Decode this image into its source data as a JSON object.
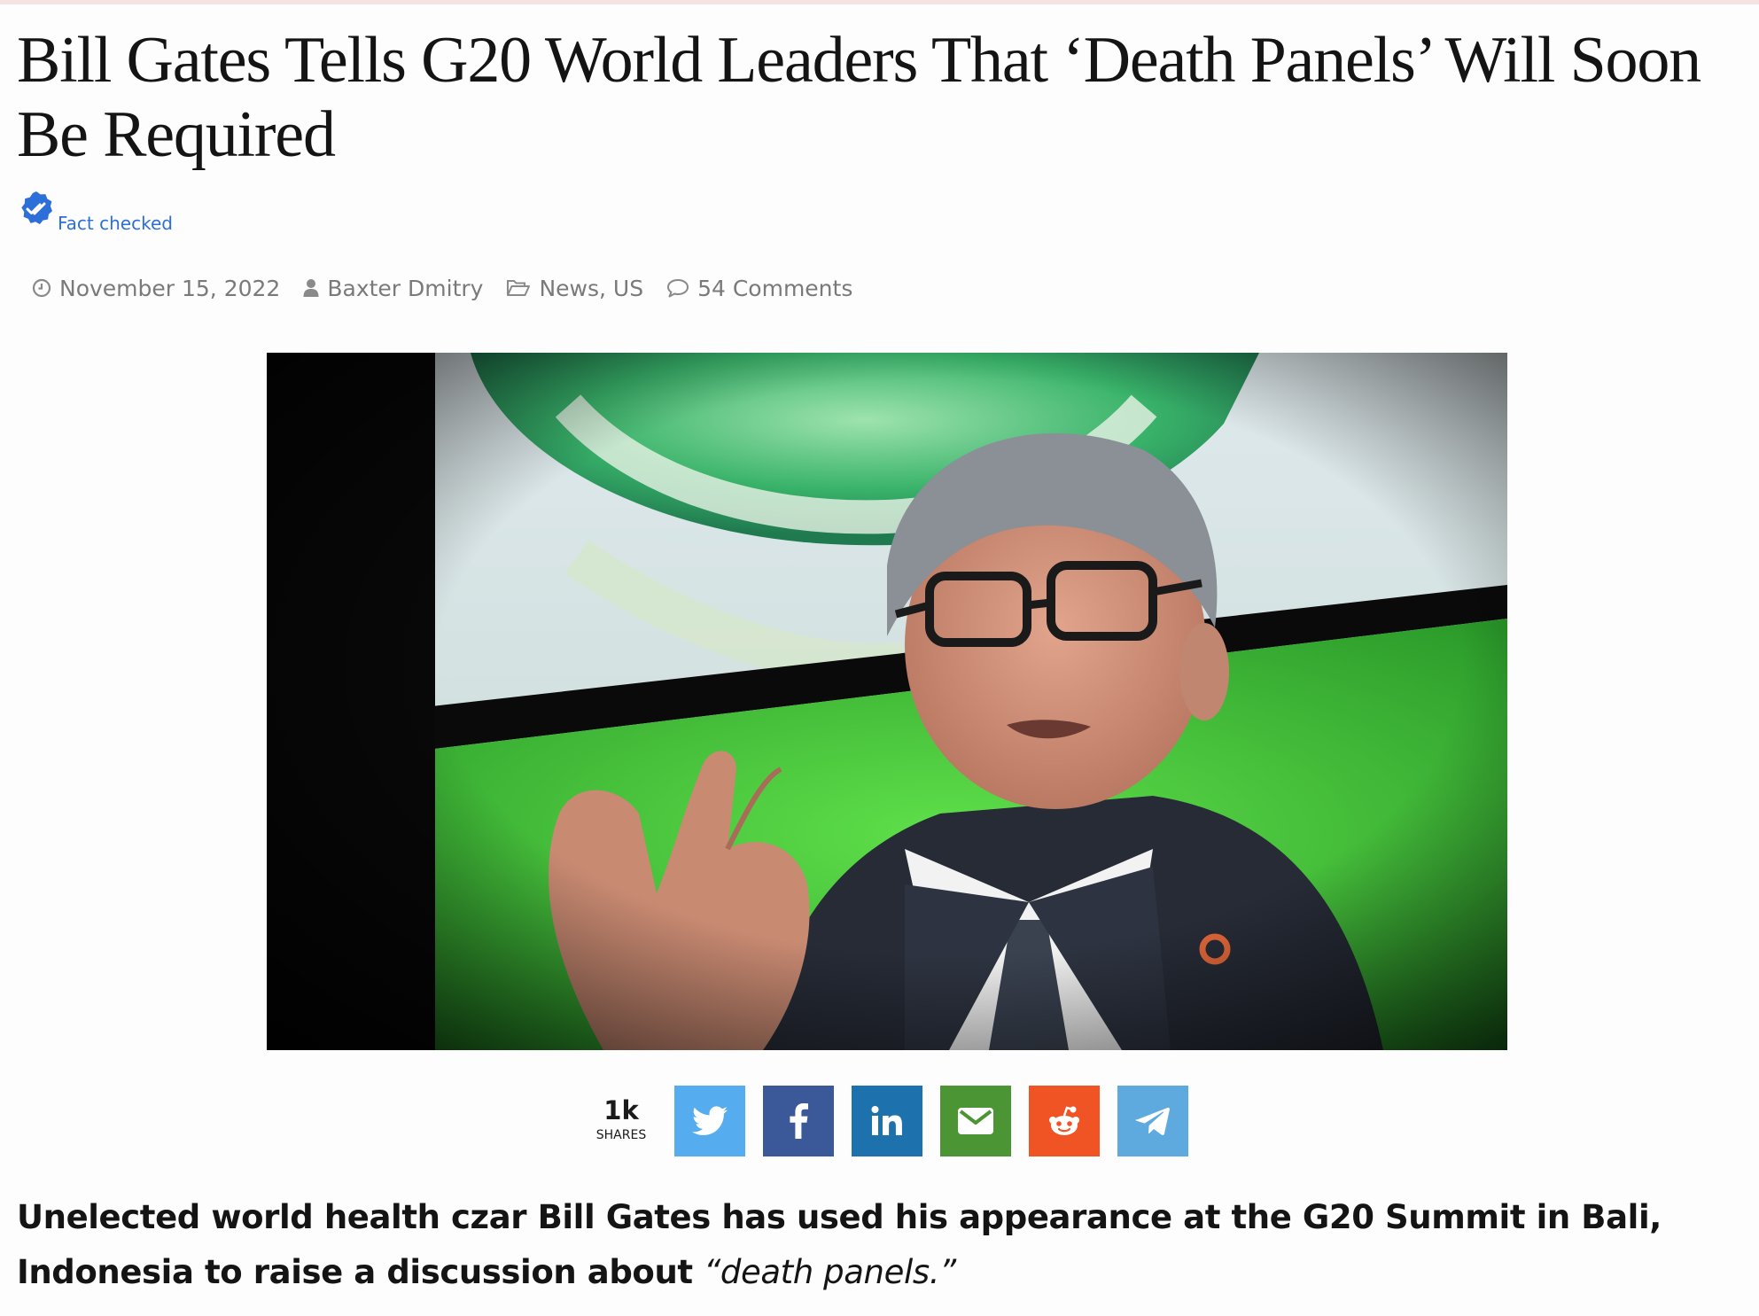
{
  "article": {
    "headline": "Bill Gates Tells G20 World Leaders That ‘Death Panels’ Will Soon Be Required",
    "fact_check_label": "Fact checked",
    "meta": {
      "date": "November 15, 2022",
      "author": "Baxter Dmitry",
      "categories": "News, US",
      "comments": "54 Comments"
    },
    "image_subject": "Bill Gates speaking in front of a green-and-white backdrop",
    "lede_bold": "Unelected world health czar Bill Gates has used his appearance at the G20 Summit in Bali, Indonesia to raise a discussion about ",
    "lede_italic": "“death panels.”"
  },
  "share": {
    "count": "1k",
    "caption": "SHARES",
    "buttons": [
      {
        "network": "twitter",
        "icon": "twitter-icon",
        "color": "#55acee"
      },
      {
        "network": "facebook",
        "icon": "facebook-icon",
        "color": "#3b5998"
      },
      {
        "network": "linkedin",
        "icon": "linkedin-icon",
        "color": "#1d72ae"
      },
      {
        "network": "email",
        "icon": "envelope-icon",
        "color": "#4b9535"
      },
      {
        "network": "reddit",
        "icon": "reddit-icon",
        "color": "#f05324"
      },
      {
        "network": "telegram",
        "icon": "telegram-icon",
        "color": "#5ea9dd"
      }
    ]
  },
  "colors": {
    "fact_check_blue": "#2d6fd8",
    "meta_gray": "#7a7a7a",
    "text": "#141414"
  }
}
